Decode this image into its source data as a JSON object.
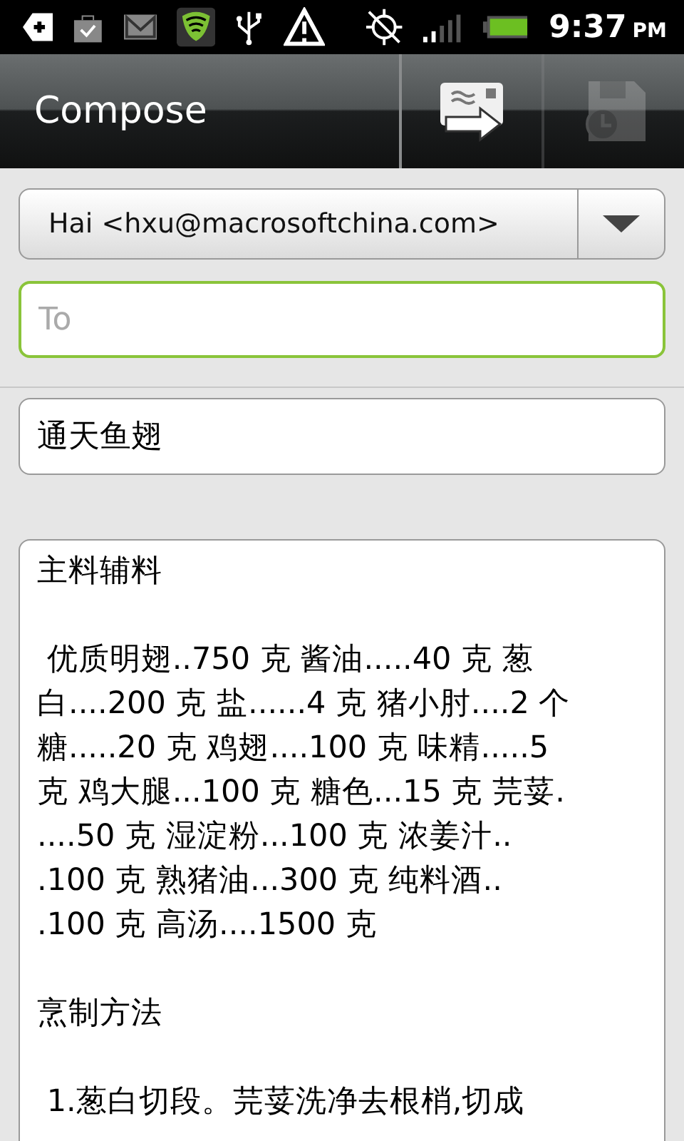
{
  "status_bar": {
    "time": "9:37",
    "meridiem": "PM"
  },
  "title_bar": {
    "title": "Compose",
    "actions": [
      {
        "kind": "send",
        "disabled": false
      },
      {
        "kind": "save_draft",
        "disabled": true
      }
    ]
  },
  "from": {
    "value": "Hai <hxu@macrosoftchina.com>"
  },
  "to": {
    "placeholder": "To",
    "focused": true
  },
  "subject": {
    "value": "通天鱼翅"
  },
  "body": {
    "paragraphs": [
      [
        "主料辅料"
      ],
      [
        " 优质明翅..750 克 酱油.....40 克 葱",
        "白....200 克 盐......4 克 猪小肘....2 个",
        "糖.....20 克 鸡翅....100 克 味精.....5",
        "克 鸡大腿...100 克 糖色...15 克 芫荽.",
        "....50 克 湿淀粉...100 克 浓姜汁..",
        ".100 克 熟猪油...300 克 纯料酒..",
        ".100 克 高汤....1500 克"
      ],
      [
        "烹制方法"
      ],
      [
        " 1.葱白切段。芫荽洗净去根梢,切成"
      ]
    ]
  }
}
